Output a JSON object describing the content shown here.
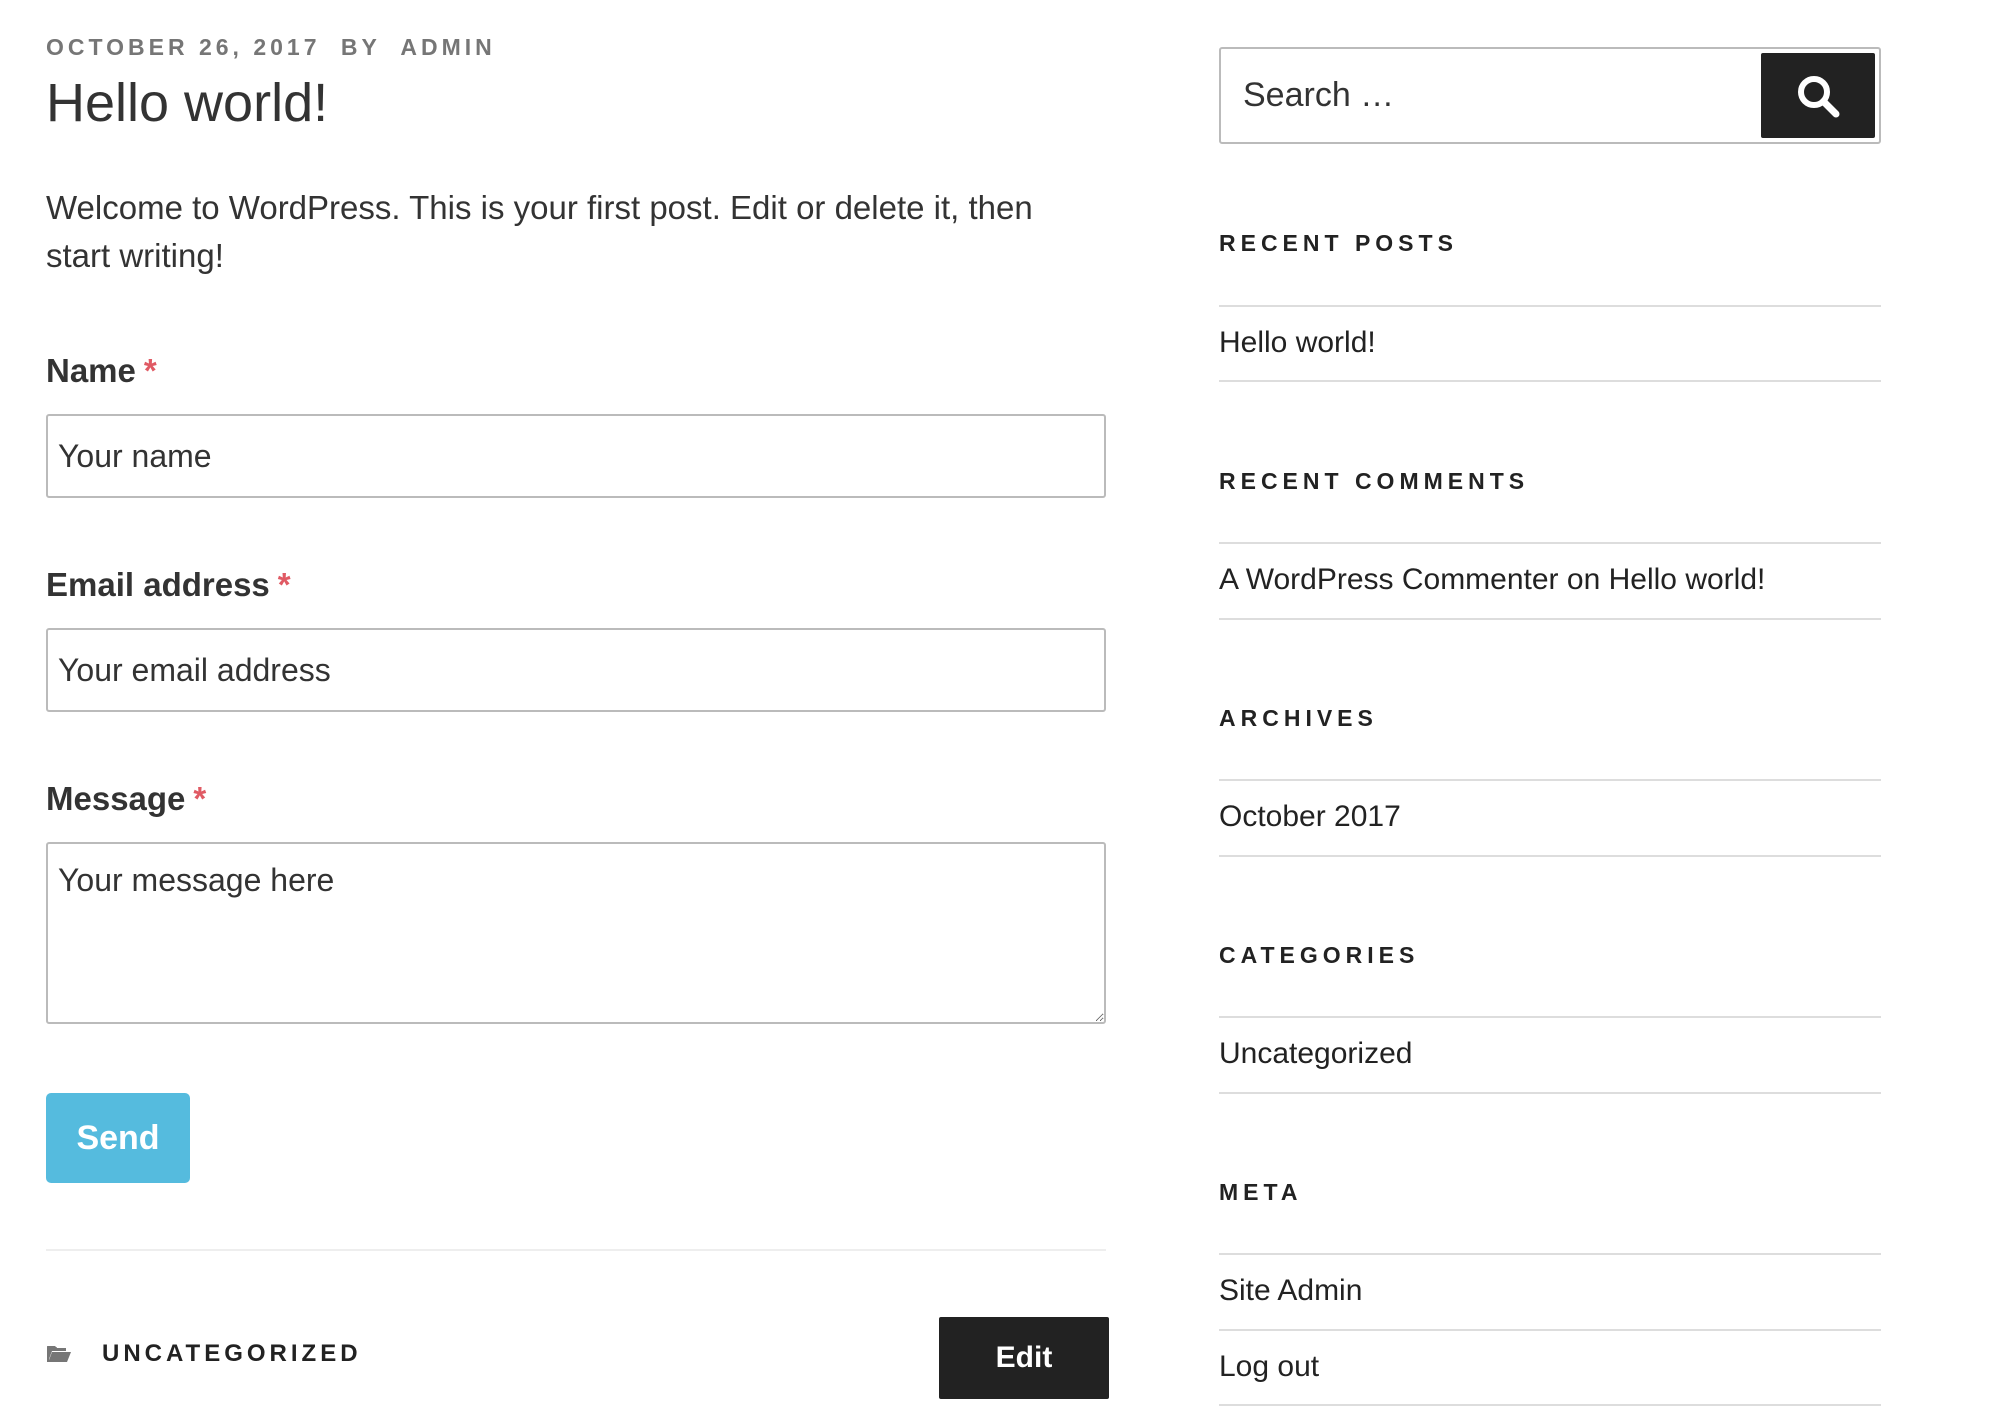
{
  "post": {
    "date": "October 26, 2017",
    "by": "by",
    "author": "admin",
    "title": "Hello world!",
    "content": "Welcome to WordPress. This is your first post. Edit or delete it, then start writing!"
  },
  "form": {
    "name_label": "Name",
    "name_placeholder": "Your name",
    "email_label": "Email address",
    "email_placeholder": "Your email address",
    "message_label": "Message",
    "message_placeholder": "Your message here",
    "required_mark": "*",
    "send_label": "Send"
  },
  "footer": {
    "category": "Uncategorized",
    "edit_label": "Edit",
    "category_icon": "folder-icon"
  },
  "sidebar": {
    "search_placeholder": "Search …",
    "search_icon": "search-icon",
    "recent_posts": {
      "title": "Recent Posts",
      "items": [
        "Hello world!"
      ]
    },
    "recent_comments": {
      "title": "Recent Comments",
      "author": "A WordPress Commenter",
      "on": "on",
      "post": "Hello world!"
    },
    "archives": {
      "title": "Archives",
      "items": [
        "October 2017"
      ]
    },
    "categories": {
      "title": "Categories",
      "items": [
        "Uncategorized"
      ]
    },
    "meta": {
      "title": "Meta",
      "items": [
        "Site Admin",
        "Log out"
      ]
    }
  },
  "colors": {
    "accent": "#55bbde",
    "required": "#e05a64",
    "dark_button": "#222222",
    "meta_text": "#767676"
  }
}
